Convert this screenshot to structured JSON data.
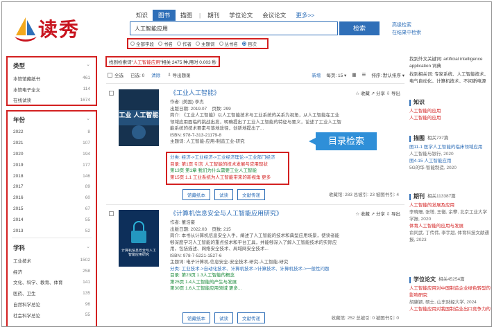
{
  "logo": {
    "text": "读秀"
  },
  "nav": {
    "tabs": [
      "知识",
      "图书",
      "描图",
      "期刊",
      "学位论文",
      "会议论文",
      "更多>>"
    ],
    "active": "图书"
  },
  "search": {
    "value": "人工智能应用",
    "button": "检索",
    "advanced": "高级检索",
    "within": "在结果中检索"
  },
  "fields": [
    "全部字段",
    "书名",
    "作者",
    "主题词",
    "丛书名",
    "目次"
  ],
  "facets": {
    "type": {
      "title": "类型",
      "items": [
        {
          "label": "本馆馆藏纸书",
          "n": "461"
        },
        {
          "label": "本馆电子全文",
          "n": "114"
        },
        {
          "label": "在线试读",
          "n": "1674"
        }
      ]
    },
    "year": {
      "title": "年份",
      "items": [
        {
          "label": "2022",
          "n": "8"
        },
        {
          "label": "2021",
          "n": "107"
        },
        {
          "label": "2020",
          "n": "194"
        },
        {
          "label": "2019",
          "n": "177"
        },
        {
          "label": "2018",
          "n": "146"
        },
        {
          "label": "2017",
          "n": "89"
        },
        {
          "label": "2016",
          "n": "60"
        },
        {
          "label": "2015",
          "n": "67"
        },
        {
          "label": "2014",
          "n": "55"
        },
        {
          "label": "2013",
          "n": "52"
        }
      ]
    },
    "subject": {
      "title": "学科",
      "items": [
        {
          "label": "工业技术",
          "n": "1502"
        },
        {
          "label": "经济",
          "n": "258"
        },
        {
          "label": "文化、科学、教育、体育",
          "n": "141"
        },
        {
          "label": "医药、卫生",
          "n": "135"
        },
        {
          "label": "自然科学总论",
          "n": "96"
        },
        {
          "label": "社会科学总论",
          "n": "55"
        }
      ]
    }
  },
  "results": {
    "msg_pre": "找到检索词\"",
    "keyword": "人工智能应用",
    "msg_post": "\"相关 2475 种,用时 0.003 秒",
    "toolbar": {
      "select_all": "全选",
      "selected": "已选: 0",
      "clear": "清除",
      "export": "导出题录",
      "newest": "新增",
      "per_page": "每页: 15 ▾",
      "sort": "排序: 默认排序 ▾"
    }
  },
  "books": [
    {
      "title": "《工业人工智能》",
      "author": "作者: (美国) 李杰",
      "date": "出版日期: 2019.07",
      "pages": "页数: 299",
      "abstract": "简介: 《工业人工智能》以人工智能技术与工业系统的关系为视角，从人工智能在工业领域应用面临的挑战出发，明确提出了工业人工智能的特征与要义，论述了工业人工智能系统的技术要素与落地途径，创新地提出了...",
      "isbn": "ISBN: 978-7-313-21179-8",
      "subject": "主题词: 人工智能-应用-制造工业-研究",
      "classify": "分类: 经济->工业经济->工业经济理论->工业部门经济",
      "toc": [
        "目录: 第1页 引言 人工智能的技术发展与应用现状",
        "第13页 第1章 我们为什么需要工业人工智能",
        "第15页 1.1 工业系统为人工智能带来的新视角 更多"
      ],
      "btns": [
        "馆藏纸本",
        "试读",
        "文献传递"
      ],
      "stats": "收藏馆: 283  总被引: 23  被图书引: 4",
      "actions": "☆ 收藏  ↗ 分享  ⇩ 导出",
      "cover_text": "工业 人工智能"
    },
    {
      "title": "《计算机信息安全与人工智能应用研究》",
      "author": "作者: 董浩豪",
      "date": "出版日期: 2022.03",
      "pages": "页数: 215",
      "abstract": "简介: 本书从计算机信息安全入手，阐述了人工智能的技术和典型应用场景，使读者能够深度学习人工智能的重点技术和平台工具，并能够深入了解人工智能技术的实际应用，包括描述、网络安全技术、局域网安全技术...",
      "isbn": "ISBN: 978-7-5221-1527-6",
      "subject": "主题词: 电子计算机-信息安全-安全技术-研究-人工智能-研究",
      "classify": "分类: 工业技术->自动化技术、计算机技术->计算技术、计算机技术->一般性问题",
      "toc": [
        "目录: 第23页 1.3人工智能的概念",
        "第25页 1.4人工智能的产生与发展",
        "第30页 1.6人工智能应用领域 更多..."
      ],
      "btns": [
        "馆藏纸本",
        "试读",
        "文献传递"
      ],
      "stats": "收藏馆: 252  总被引: 0  被图书引: 0",
      "actions": "☆ 收藏  ↗ 分享  ⇩ 导出",
      "cover_text": "计算机信息安全与人工智能应用研究"
    }
  ],
  "callout": "目录检索",
  "right_panel": {
    "english": "找到外文关键词: artificial intelligence application 词典",
    "related": "找到相关词: 专家系统、人工智能技术、电气自动化、计算机技术、不间断电源",
    "knowledge": {
      "title": "知识",
      "items": [
        "人工智能的应用",
        "人工智能的应用"
      ]
    },
    "images": {
      "title": "描图",
      "count": "相关737篇",
      "items": [
        "图11-1 医学人工智能的临床领域应用",
        "人工智能与银行, 2020",
        "图4-15 人工智能应用",
        "5G的华-智能制造, 2020"
      ]
    },
    "journals": {
      "title": "期刊",
      "count": "相关113387篇",
      "items": [
        "人工智能的发展及应用",
        "李晓珊, 张增, 王徽, 余攀, 北京工业大学学报, 2020",
        "体育人工智能的应用与发展",
        "俞同武, 丁传伟, 李宇超, 体育科技文献通报, 2023"
      ]
    },
    "theses": {
      "title": "学位论文",
      "count": "相关45254篇",
      "items": [
        "人工智能应用对中国制造企业绿色转型的影响研究",
        "胡康颖, 硕士, 山东财经大学, 2024",
        "人工智能应用对我国制造业出口竞争力的"
      ]
    }
  }
}
